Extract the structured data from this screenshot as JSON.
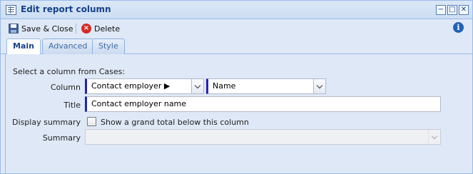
{
  "window": {
    "title": "Edit report column",
    "icon": "report-table-icon",
    "controls": {
      "minimize": "−",
      "maximize": "□",
      "close": "✕"
    }
  },
  "toolbar": {
    "save_label": "Save & Close",
    "delete_label": "Delete",
    "delete_icon_glyph": "×",
    "info_glyph": "i"
  },
  "tabs": [
    {
      "label": "Main",
      "active": true
    },
    {
      "label": "Advanced",
      "active": false
    },
    {
      "label": "Style",
      "active": false
    }
  ],
  "form": {
    "intro": "Select a column from Cases:",
    "column_label": "Column",
    "column_value_1": "Contact employer ▶",
    "column_value_2": "Name",
    "title_label": "Title",
    "title_value": "Contact employer name",
    "display_summary_label": "Display summary",
    "display_summary_checkbox_label": "Show a grand total below this column",
    "display_summary_checked": false,
    "summary_label": "Summary",
    "summary_value": ""
  },
  "colors": {
    "accent_marker": "#2222b8",
    "title_text": "#15428b",
    "panel_bg": "#dfe8f6",
    "border": "#99bbe8"
  }
}
